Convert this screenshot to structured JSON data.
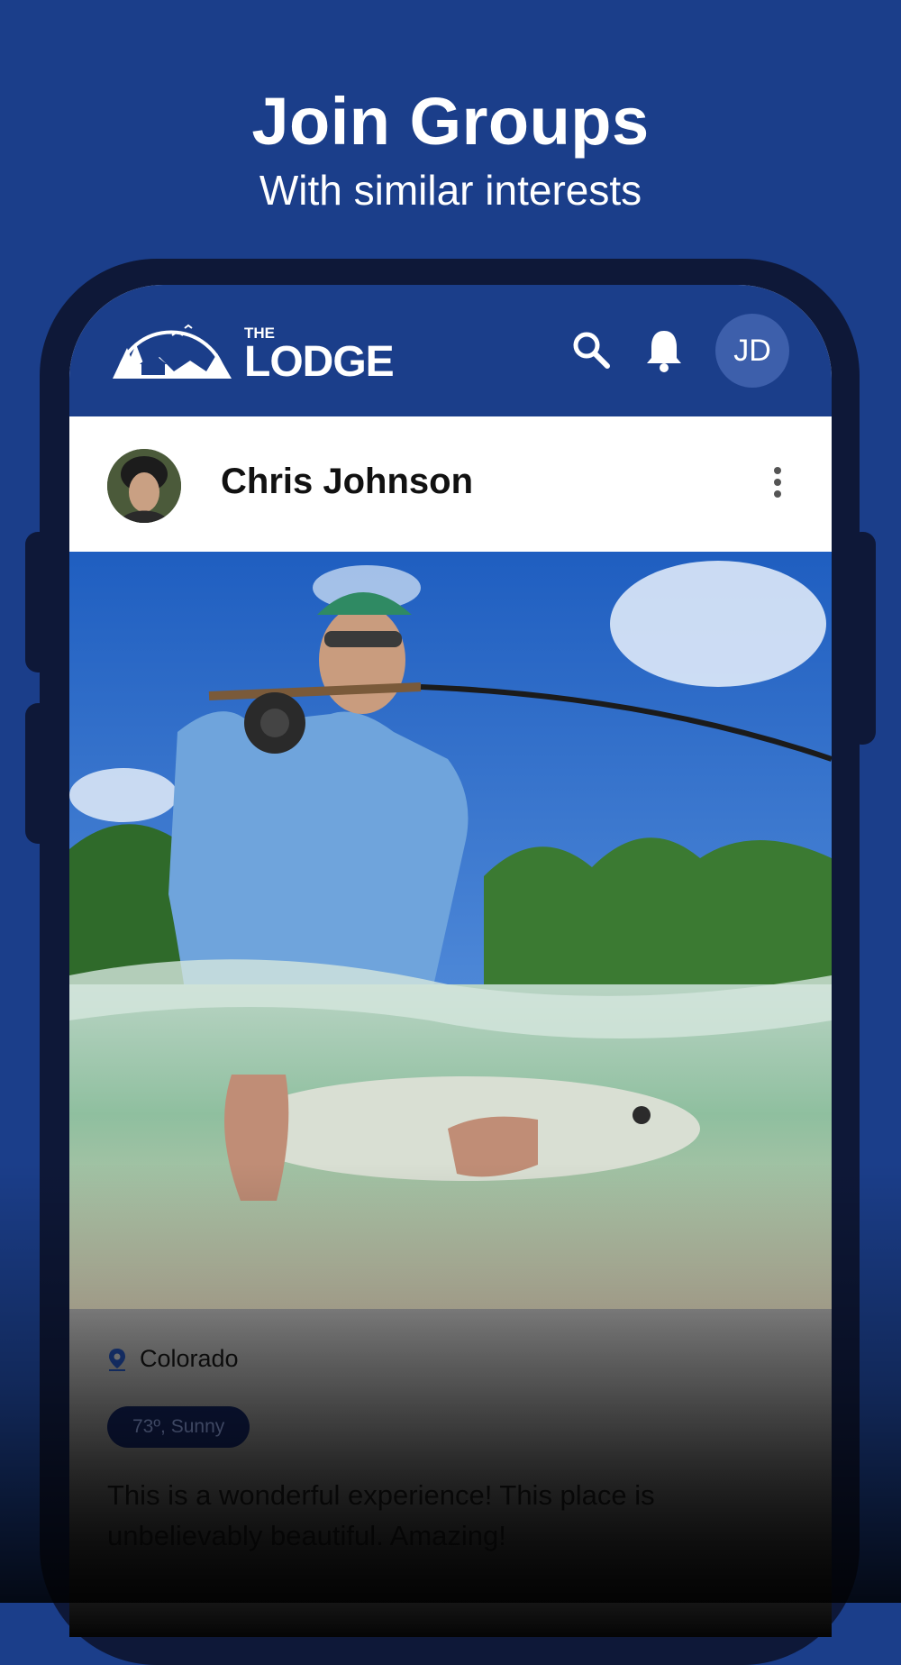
{
  "promo": {
    "title": "Join Groups",
    "subtitle": "With similar interests"
  },
  "app": {
    "logo_small": "THE",
    "logo_large": "LODGE",
    "user_initials": "JD",
    "icons": [
      "search-icon",
      "bell-icon"
    ]
  },
  "post": {
    "author": "Chris Johnson",
    "location": "Colorado",
    "weather": "73º, Sunny",
    "caption": "This is a wonderful experience! This place is unbelievably beautiful. Amazing!"
  },
  "colors": {
    "brand_blue": "#1b3e8a",
    "phone_frame": "#0e1838",
    "avatar_bg": "#3d5fab"
  }
}
